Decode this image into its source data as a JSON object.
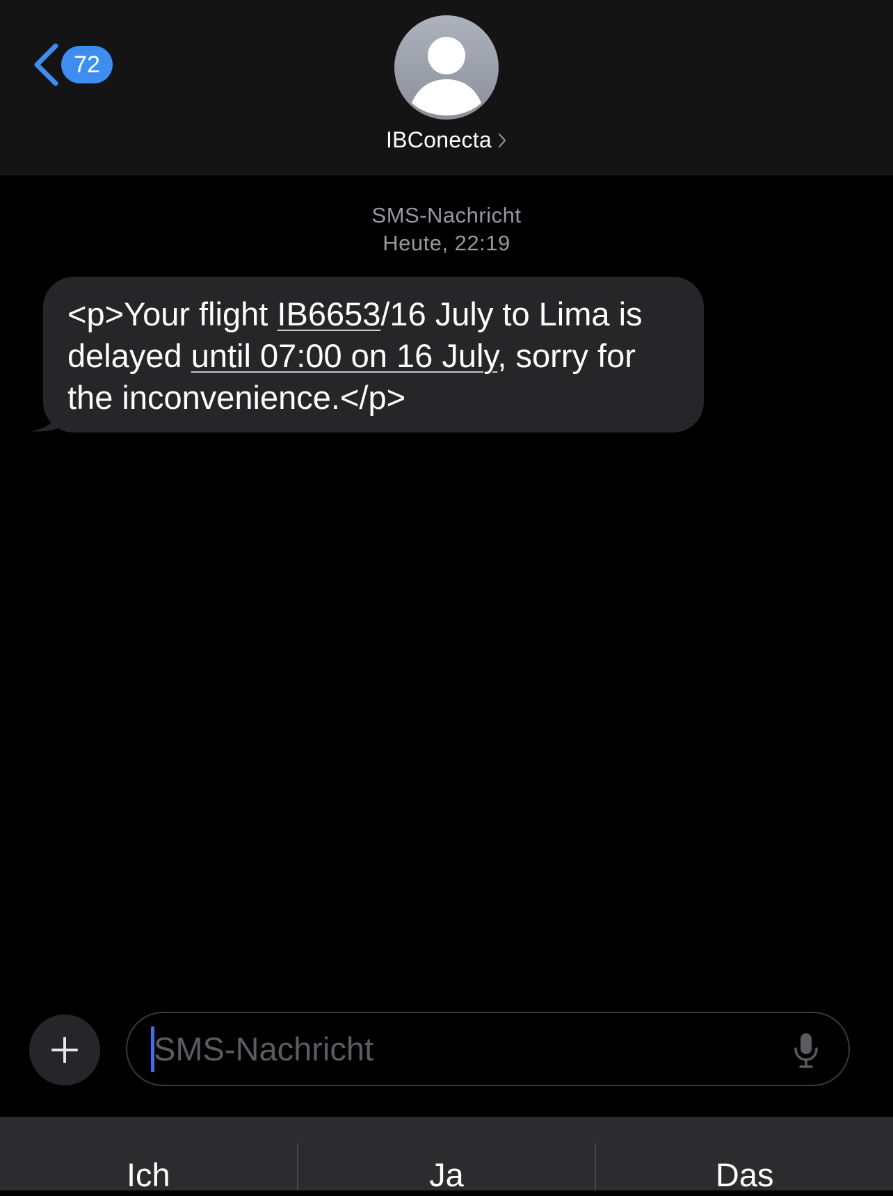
{
  "header": {
    "back_icon": "chevron-left-icon",
    "unread_count": "72",
    "avatar_icon": "person-silhouette-icon",
    "contact_name": "IBConecta",
    "contact_chevron_icon": "chevron-right-icon"
  },
  "thread": {
    "message_type": "SMS-Nachricht",
    "timestamp": "Heute, 22:19",
    "message": {
      "part1": "<p>Your flight ",
      "link1": "IB6653",
      "part2": "/16 July to Lima is delayed ",
      "link2": "until 07:00 on 16 July",
      "part3": ", sorry for the inconvenience.</p>"
    }
  },
  "compose": {
    "plus_icon": "plus-icon",
    "placeholder": "SMS-Nachricht",
    "value": "",
    "mic_icon": "microphone-icon"
  },
  "suggestions": [
    "Ich",
    "Ja",
    "Das"
  ],
  "colors": {
    "accent": "#3d8ef0",
    "bubble": "#262628",
    "header_bg": "#141414",
    "keyboard_bg": "#2c2c2e",
    "secondary_text": "#98989e"
  }
}
